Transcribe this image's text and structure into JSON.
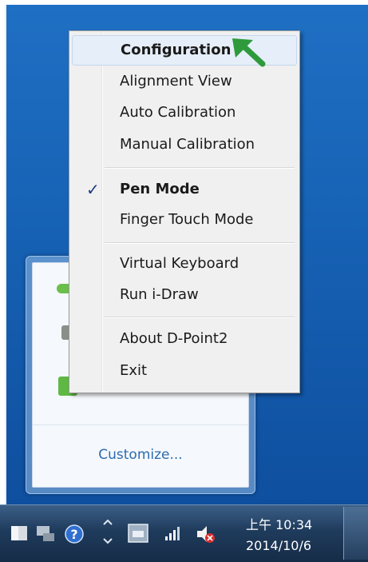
{
  "context_menu": {
    "items": [
      {
        "label": "Configuration",
        "bold": true,
        "highlighted": true,
        "checked": false
      },
      {
        "label": "Alignment View",
        "bold": false,
        "highlighted": false,
        "checked": false
      },
      {
        "label": "Auto Calibration",
        "bold": false,
        "highlighted": false,
        "checked": false
      },
      {
        "label": "Manual Calibration",
        "bold": false,
        "highlighted": false,
        "checked": false
      },
      {
        "label": "Pen Mode",
        "bold": true,
        "highlighted": false,
        "checked": true
      },
      {
        "label": "Finger Touch Mode",
        "bold": false,
        "highlighted": false,
        "checked": false
      },
      {
        "label": "Virtual Keyboard",
        "bold": false,
        "highlighted": false,
        "checked": false
      },
      {
        "label": "Run i-Draw",
        "bold": false,
        "highlighted": false,
        "checked": false
      },
      {
        "label": "About D-Point2",
        "bold": false,
        "highlighted": false,
        "checked": false
      },
      {
        "label": "Exit",
        "bold": false,
        "highlighted": false,
        "checked": false
      }
    ],
    "check_glyph": "✓"
  },
  "flyout": {
    "customize_label": "Customize..."
  },
  "taskbar": {
    "clock_time": "上午 10:34",
    "clock_date": "2014/10/6"
  },
  "colors": {
    "annotation_arrow": "#2e9a3c",
    "desktop": "#1763b6",
    "menu_background": "#f0f0f0"
  },
  "icons": [
    "pointing-arrow-icon",
    "flag-icon",
    "network-icon",
    "help-icon",
    "expand-tray-icon",
    "window-icon",
    "signal-icon",
    "volume-icon"
  ]
}
